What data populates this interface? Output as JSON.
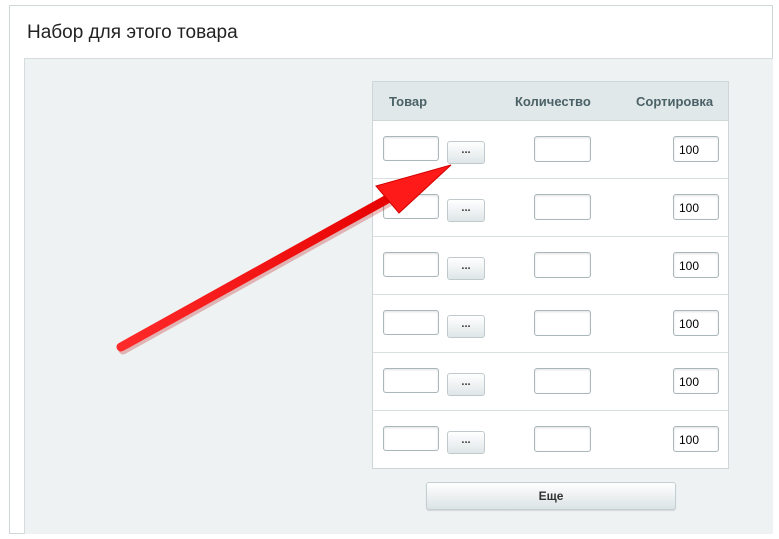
{
  "section": {
    "title": "Набор для этого товара"
  },
  "table": {
    "headers": {
      "product": "Товар",
      "quantity": "Количество",
      "sort": "Сортировка"
    },
    "rows": [
      {
        "product": "",
        "quantity": "",
        "sort": "100"
      },
      {
        "product": "",
        "quantity": "",
        "sort": "100"
      },
      {
        "product": "",
        "quantity": "",
        "sort": "100"
      },
      {
        "product": "",
        "quantity": "",
        "sort": "100"
      },
      {
        "product": "",
        "quantity": "",
        "sort": "100"
      },
      {
        "product": "",
        "quantity": "",
        "sort": "100"
      }
    ],
    "browse_label": "..."
  },
  "more_button": {
    "label": "Еще"
  },
  "annotation": {
    "icon": "red-arrow-icon",
    "color": "#ff1a1a"
  }
}
